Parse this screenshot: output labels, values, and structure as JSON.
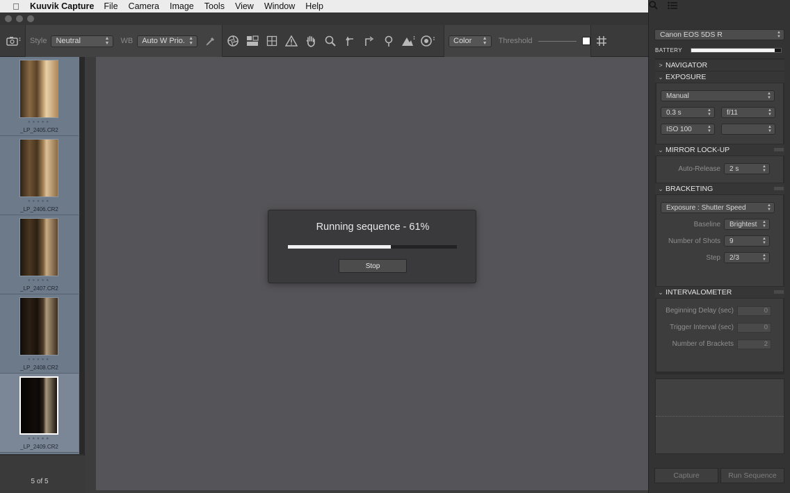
{
  "menubar": {
    "app": "Kuuvik Capture",
    "items": [
      "File",
      "Camera",
      "Image",
      "Tools",
      "View",
      "Window",
      "Help"
    ]
  },
  "toolbar": {
    "style_label": "Style",
    "style_value": "Neutral",
    "wb_label": "WB",
    "wb_value": "Auto W Prio.",
    "color_value": "Color",
    "threshold_label": "Threshold"
  },
  "filmstrip": {
    "items": [
      {
        "name": "_LP_2405.CR2",
        "stars": "●●●●●"
      },
      {
        "name": "_LP_2406.CR2",
        "stars": "●●●●●"
      },
      {
        "name": "_LP_2407.CR2",
        "stars": "●●●●●"
      },
      {
        "name": "_LP_2408.CR2",
        "stars": "●●●●●"
      },
      {
        "name": "_LP_2409.CR2",
        "stars": "●●●●●"
      }
    ],
    "count": "5 of 5"
  },
  "dialog": {
    "title": "Running sequence - 61%",
    "progress": 0.61,
    "stop_label": "Stop"
  },
  "camera": {
    "model": "Canon EOS 5DS R",
    "battery_label": "BATTERY",
    "battery_level": 0.93
  },
  "sections": {
    "navigator": "NAVIGATOR",
    "exposure": "EXPOSURE",
    "mirror": "MIRROR LOCK-UP",
    "bracketing": "BRACKETING",
    "intervalometer": "INTERVALOMETER"
  },
  "exposure": {
    "mode": "Manual",
    "shutter": "0.3 s",
    "aperture": "f/11",
    "iso": "ISO 100",
    "extra": ""
  },
  "mirror": {
    "auto_release_label": "Auto-Release",
    "auto_release": "2 s"
  },
  "bracketing": {
    "mode": "Exposure : Shutter Speed",
    "baseline_label": "Baseline",
    "baseline": "Brightest",
    "shots_label": "Number of Shots",
    "shots": "9",
    "step_label": "Step",
    "step": "2/3"
  },
  "intervalometer": {
    "delay_label": "Beginning Delay (sec)",
    "delay": "0",
    "interval_label": "Trigger Interval (sec)",
    "interval": "0",
    "brackets_label": "Number of Brackets",
    "brackets": "2"
  },
  "buttons": {
    "capture": "Capture",
    "run_sequence": "Run Sequence"
  }
}
